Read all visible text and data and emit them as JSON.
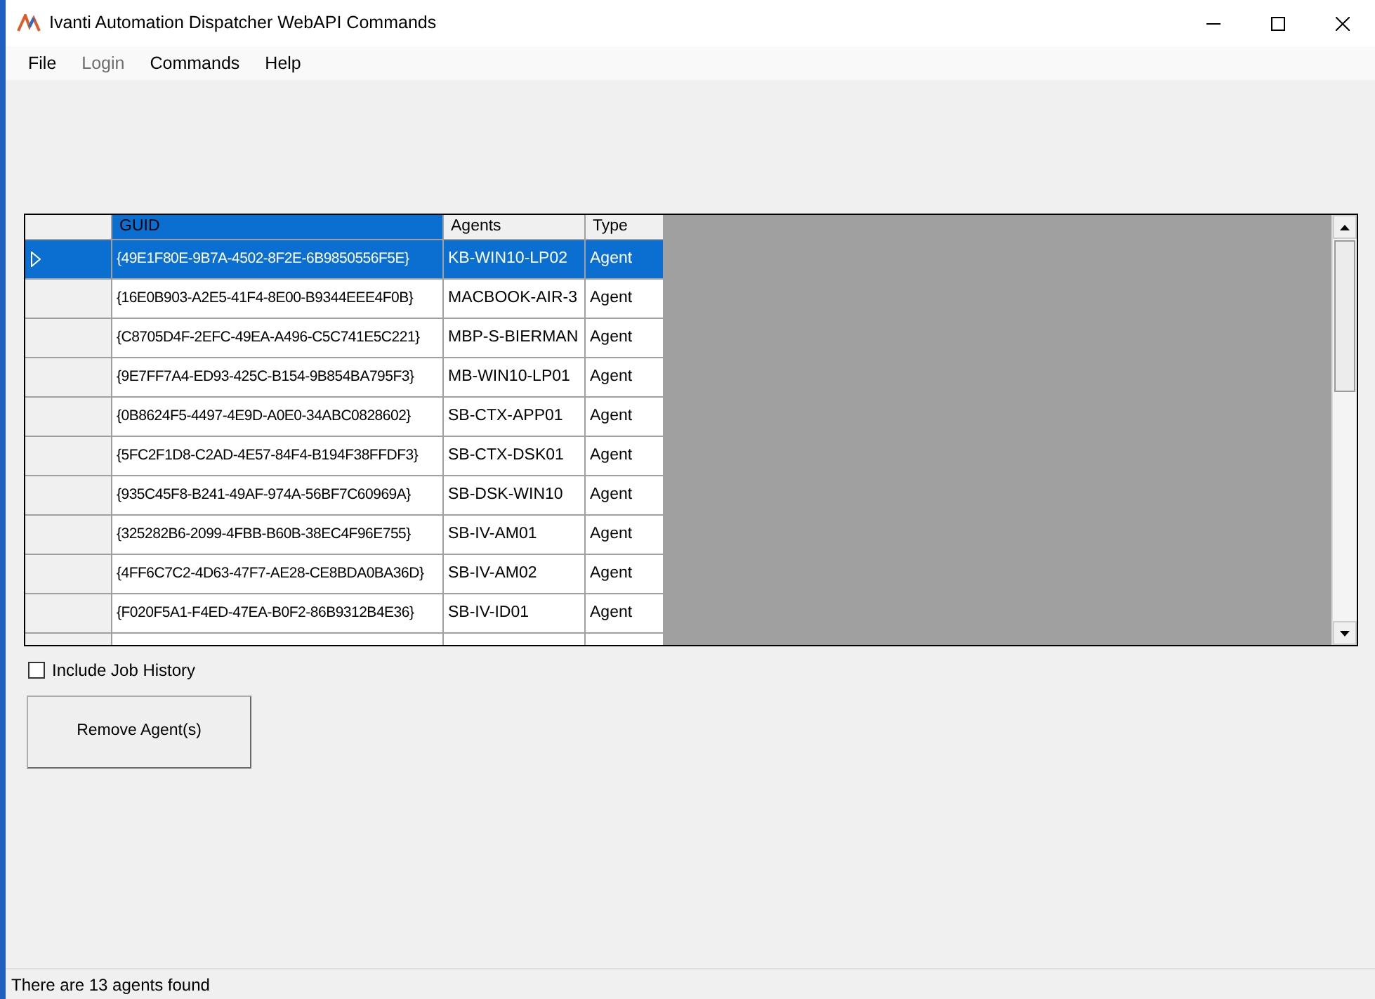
{
  "window": {
    "title": "Ivanti Automation Dispatcher WebAPI Commands"
  },
  "menu": [
    {
      "label": "File",
      "disabled": false
    },
    {
      "label": "Login",
      "disabled": true
    },
    {
      "label": "Commands",
      "disabled": false
    },
    {
      "label": "Help",
      "disabled": false
    }
  ],
  "table": {
    "columns": [
      "GUID",
      "Agents",
      "Type"
    ],
    "rows": [
      {
        "guid": "{49E1F80E-9B7A-4502-8F2E-6B9850556F5E}",
        "agent": "KB-WIN10-LP02",
        "type": "Agent",
        "selected": true
      },
      {
        "guid": "{16E0B903-A2E5-41F4-8E00-B9344EEE4F0B}",
        "agent": "MACBOOK-AIR-3",
        "type": "Agent",
        "selected": false
      },
      {
        "guid": "{C8705D4F-2EFC-49EA-A496-C5C741E5C221}",
        "agent": "MBP-S-BIERMAN",
        "type": "Agent",
        "selected": false
      },
      {
        "guid": "{9E7FF7A4-ED93-425C-B154-9B854BA795F3}",
        "agent": "MB-WIN10-LP01",
        "type": "Agent",
        "selected": false
      },
      {
        "guid": "{0B8624F5-4497-4E9D-A0E0-34ABC0828602}",
        "agent": "SB-CTX-APP01",
        "type": "Agent",
        "selected": false
      },
      {
        "guid": "{5FC2F1D8-C2AD-4E57-84F4-B194F38FFDF3}",
        "agent": "SB-CTX-DSK01",
        "type": "Agent",
        "selected": false
      },
      {
        "guid": "{935C45F8-B241-49AF-974A-56BF7C60969A}",
        "agent": "SB-DSK-WIN10",
        "type": "Agent",
        "selected": false
      },
      {
        "guid": "{325282B6-2099-4FBB-B60B-38EC4F96E755}",
        "agent": "SB-IV-AM01",
        "type": "Agent",
        "selected": false
      },
      {
        "guid": "{4FF6C7C2-4D63-47F7-AE28-CE8BDA0BA36D}",
        "agent": "SB-IV-AM02",
        "type": "Agent",
        "selected": false
      },
      {
        "guid": "{F020F5A1-F4ED-47EA-B0F2-86B9312B4E36}",
        "agent": "SB-IV-ID01",
        "type": "Agent",
        "selected": false
      }
    ]
  },
  "include_job_history": {
    "label": "Include Job History",
    "checked": false
  },
  "remove_button": {
    "label": "Remove Agent(s)"
  },
  "status_bar": "There are 13 agents found"
}
